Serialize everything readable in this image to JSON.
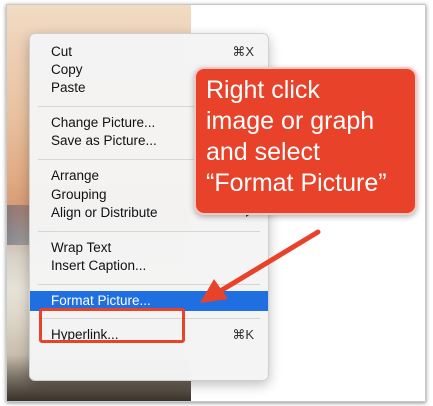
{
  "context_menu": {
    "items": [
      {
        "label": "Cut",
        "shortcut": "⌘X"
      },
      {
        "label": "Copy"
      },
      {
        "label": "Paste"
      },
      {
        "label": "Change Picture..."
      },
      {
        "label": "Save as Picture..."
      },
      {
        "label": "Arrange"
      },
      {
        "label": "Grouping"
      },
      {
        "label": "Align or Distribute",
        "submenu": true
      },
      {
        "label": "Wrap Text"
      },
      {
        "label": "Insert Caption..."
      },
      {
        "label": "Format Picture...",
        "selected": true
      },
      {
        "label": "Hyperlink...",
        "shortcut": "⌘K"
      }
    ]
  },
  "callout": {
    "text": "Right click\nimage or graph\nand select\n“Format Picture”",
    "color": "#e8432a"
  },
  "highlight_color": "#1f6fe0"
}
